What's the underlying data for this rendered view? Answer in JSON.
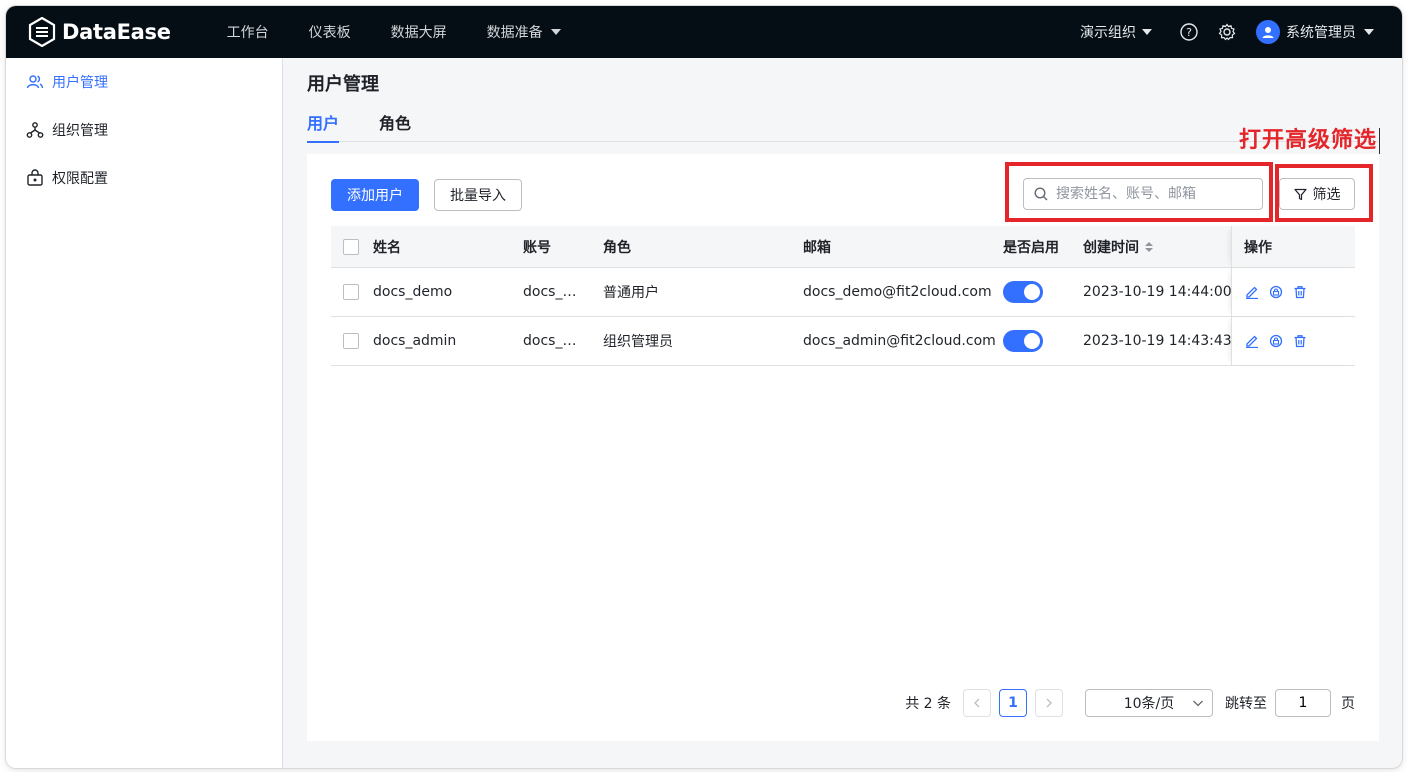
{
  "app": {
    "logo_text": "DataEase",
    "nav": [
      "工作台",
      "仪表板",
      "数据大屏",
      "数据准备"
    ],
    "org": "演示组织",
    "user": "系统管理员"
  },
  "sidebar": {
    "items": [
      {
        "label": "用户管理",
        "icon": "users-icon",
        "active": true
      },
      {
        "label": "组织管理",
        "icon": "org-tree-icon",
        "active": false
      },
      {
        "label": "权限配置",
        "icon": "lock-box-icon",
        "active": false
      }
    ]
  },
  "page": {
    "title": "用户管理",
    "tabs": [
      "用户",
      "角色"
    ],
    "annotation": "打开高级筛选"
  },
  "toolbar": {
    "add_label": "添加用户",
    "import_label": "批量导入",
    "search_placeholder": "搜索姓名、账号、邮箱",
    "filter_label": "筛选"
  },
  "table": {
    "headers": {
      "name": "姓名",
      "account": "账号",
      "role": "角色",
      "email": "邮箱",
      "enabled": "是否启用",
      "created": "创建时间",
      "ops": "操作"
    },
    "rows": [
      {
        "name": "docs_demo",
        "account": "docs_…",
        "role": "普通用户",
        "email": "docs_demo@fit2cloud.com",
        "enabled": true,
        "created": "2023-10-19 14:44:00"
      },
      {
        "name": "docs_admin",
        "account": "docs_…",
        "role": "组织管理员",
        "email": "docs_admin@fit2cloud.com",
        "enabled": true,
        "created": "2023-10-19 14:43:43"
      }
    ]
  },
  "pagination": {
    "total": "共 2 条",
    "current": "1",
    "page_size": "10条/页",
    "jump_label": "跳转至",
    "jump_value": "1",
    "page_suffix": "页"
  },
  "colors": {
    "primary": "#3370ff",
    "topbar": "#050e15",
    "annotation": "#e4262a"
  }
}
